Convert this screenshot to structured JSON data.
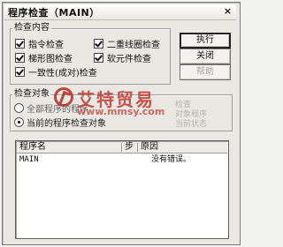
{
  "window": {
    "title": "程序检查（MAIN）",
    "close_glyph": "×"
  },
  "check_content": {
    "label": "检查内容",
    "items": [
      {
        "label": "指令检查",
        "checked": true
      },
      {
        "label": "二重线圈检查",
        "checked": true
      },
      {
        "label": "梯形图检查",
        "checked": true
      },
      {
        "label": "软元件检查",
        "checked": true
      },
      {
        "label": "一致性(成对)检查",
        "checked": true
      }
    ]
  },
  "check_target": {
    "label": "检查对象",
    "options": [
      {
        "label": "全部程序的程序",
        "selected": false
      },
      {
        "label": "当前的程序检查对象",
        "selected": true
      }
    ],
    "faded_lines": [
      "检查",
      "对象程序",
      "当前状态"
    ]
  },
  "buttons": {
    "execute": "执行",
    "close": "关闭",
    "help": "帮助"
  },
  "watermark": {
    "text": "艾特贸易",
    "url": "www.mmsy.com"
  },
  "results": {
    "columns": [
      "程序名",
      "步",
      "原因"
    ],
    "rows": [
      {
        "program": "MAIN",
        "step": "",
        "reason": "没有错误。"
      }
    ]
  },
  "colors": {
    "dialog_bg": "#eae8e2",
    "watermark_red": "#c0312a"
  }
}
